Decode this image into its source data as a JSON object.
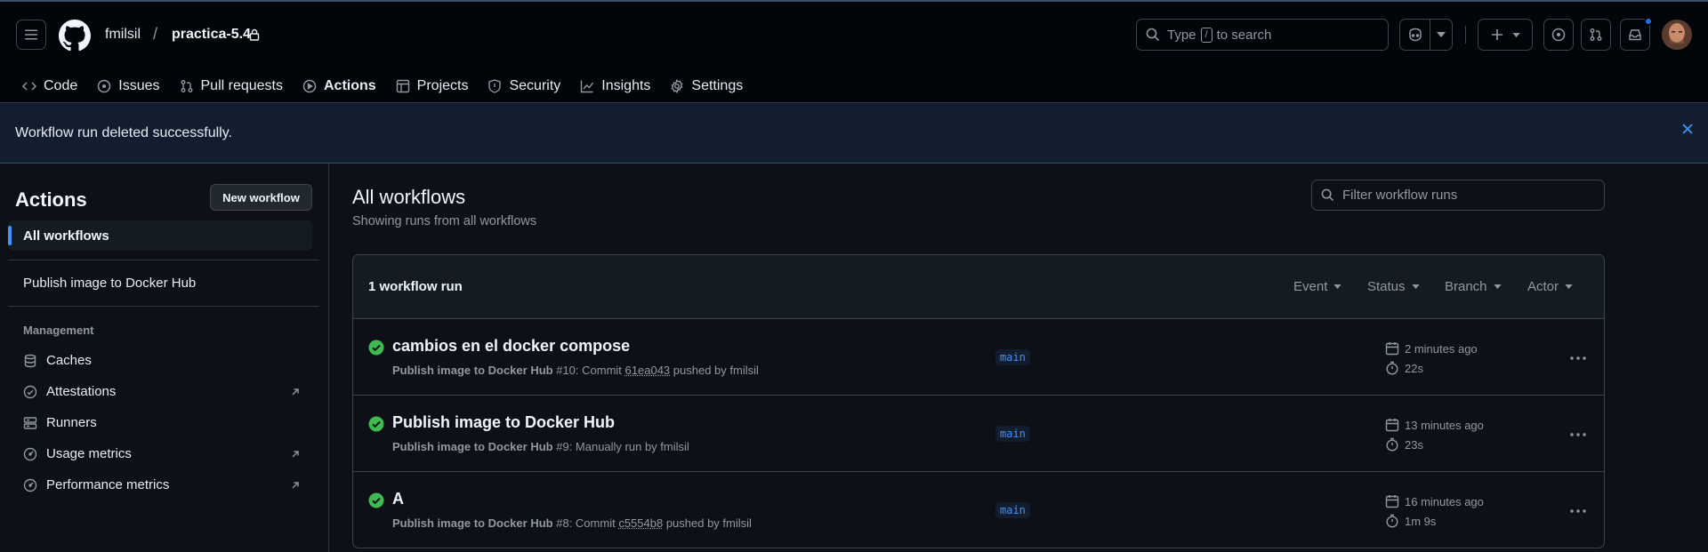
{
  "header": {
    "owner": "fmilsil",
    "separator": "/",
    "repo": "practica-5.4",
    "search_prefix": "Type",
    "search_key": "/",
    "search_suffix": "to search"
  },
  "tabs": [
    {
      "label": "Code",
      "icon": "code-icon"
    },
    {
      "label": "Issues",
      "icon": "issue-icon"
    },
    {
      "label": "Pull requests",
      "icon": "pull-request-icon"
    },
    {
      "label": "Actions",
      "icon": "play-icon",
      "active": true
    },
    {
      "label": "Projects",
      "icon": "table-icon"
    },
    {
      "label": "Security",
      "icon": "shield-icon"
    },
    {
      "label": "Insights",
      "icon": "graph-icon"
    },
    {
      "label": "Settings",
      "icon": "gear-icon"
    }
  ],
  "flash": {
    "message": "Workflow run deleted successfully."
  },
  "sidebar": {
    "title": "Actions",
    "new_workflow": "New workflow",
    "all_workflows": "All workflows",
    "workflow": "Publish image to Docker Hub",
    "management_label": "Management",
    "items": [
      {
        "label": "Caches",
        "icon": "database-icon"
      },
      {
        "label": "Attestations",
        "icon": "verified-icon",
        "external": true
      },
      {
        "label": "Runners",
        "icon": "server-icon"
      },
      {
        "label": "Usage metrics",
        "icon": "meter-icon",
        "external": true
      },
      {
        "label": "Performance metrics",
        "icon": "meter-icon",
        "external": true
      }
    ]
  },
  "main": {
    "title": "All workflows",
    "subtitle": "Showing runs from all workflows",
    "filter_placeholder": "Filter workflow runs",
    "run_count": "1 workflow run",
    "filters": [
      "Event",
      "Status",
      "Branch",
      "Actor"
    ],
    "runs": [
      {
        "title": "cambios en el docker compose",
        "workflow": "Publish image to Docker Hub",
        "number": "#10",
        "detail_pre": ": Commit ",
        "sha": "61ea043",
        "detail_post": " pushed by fmilsil",
        "branch": "main",
        "when": "2 minutes ago",
        "duration": "22s",
        "status": "success"
      },
      {
        "title": "Publish image to Docker Hub",
        "workflow": "Publish image to Docker Hub",
        "number": "#9",
        "detail_pre": ": Manually run by fmilsil",
        "sha": "",
        "detail_post": "",
        "branch": "main",
        "when": "13 minutes ago",
        "duration": "23s",
        "status": "success"
      },
      {
        "title": "A",
        "workflow": "Publish image to Docker Hub",
        "number": "#8",
        "detail_pre": ": Commit ",
        "sha": "c5554b8",
        "detail_post": " pushed by fmilsil",
        "branch": "main",
        "when": "16 minutes ago",
        "duration": "1m 9s",
        "status": "success"
      }
    ]
  },
  "colors": {
    "accent": "#f78166",
    "link": "#4493f8",
    "success": "#3fb950"
  }
}
